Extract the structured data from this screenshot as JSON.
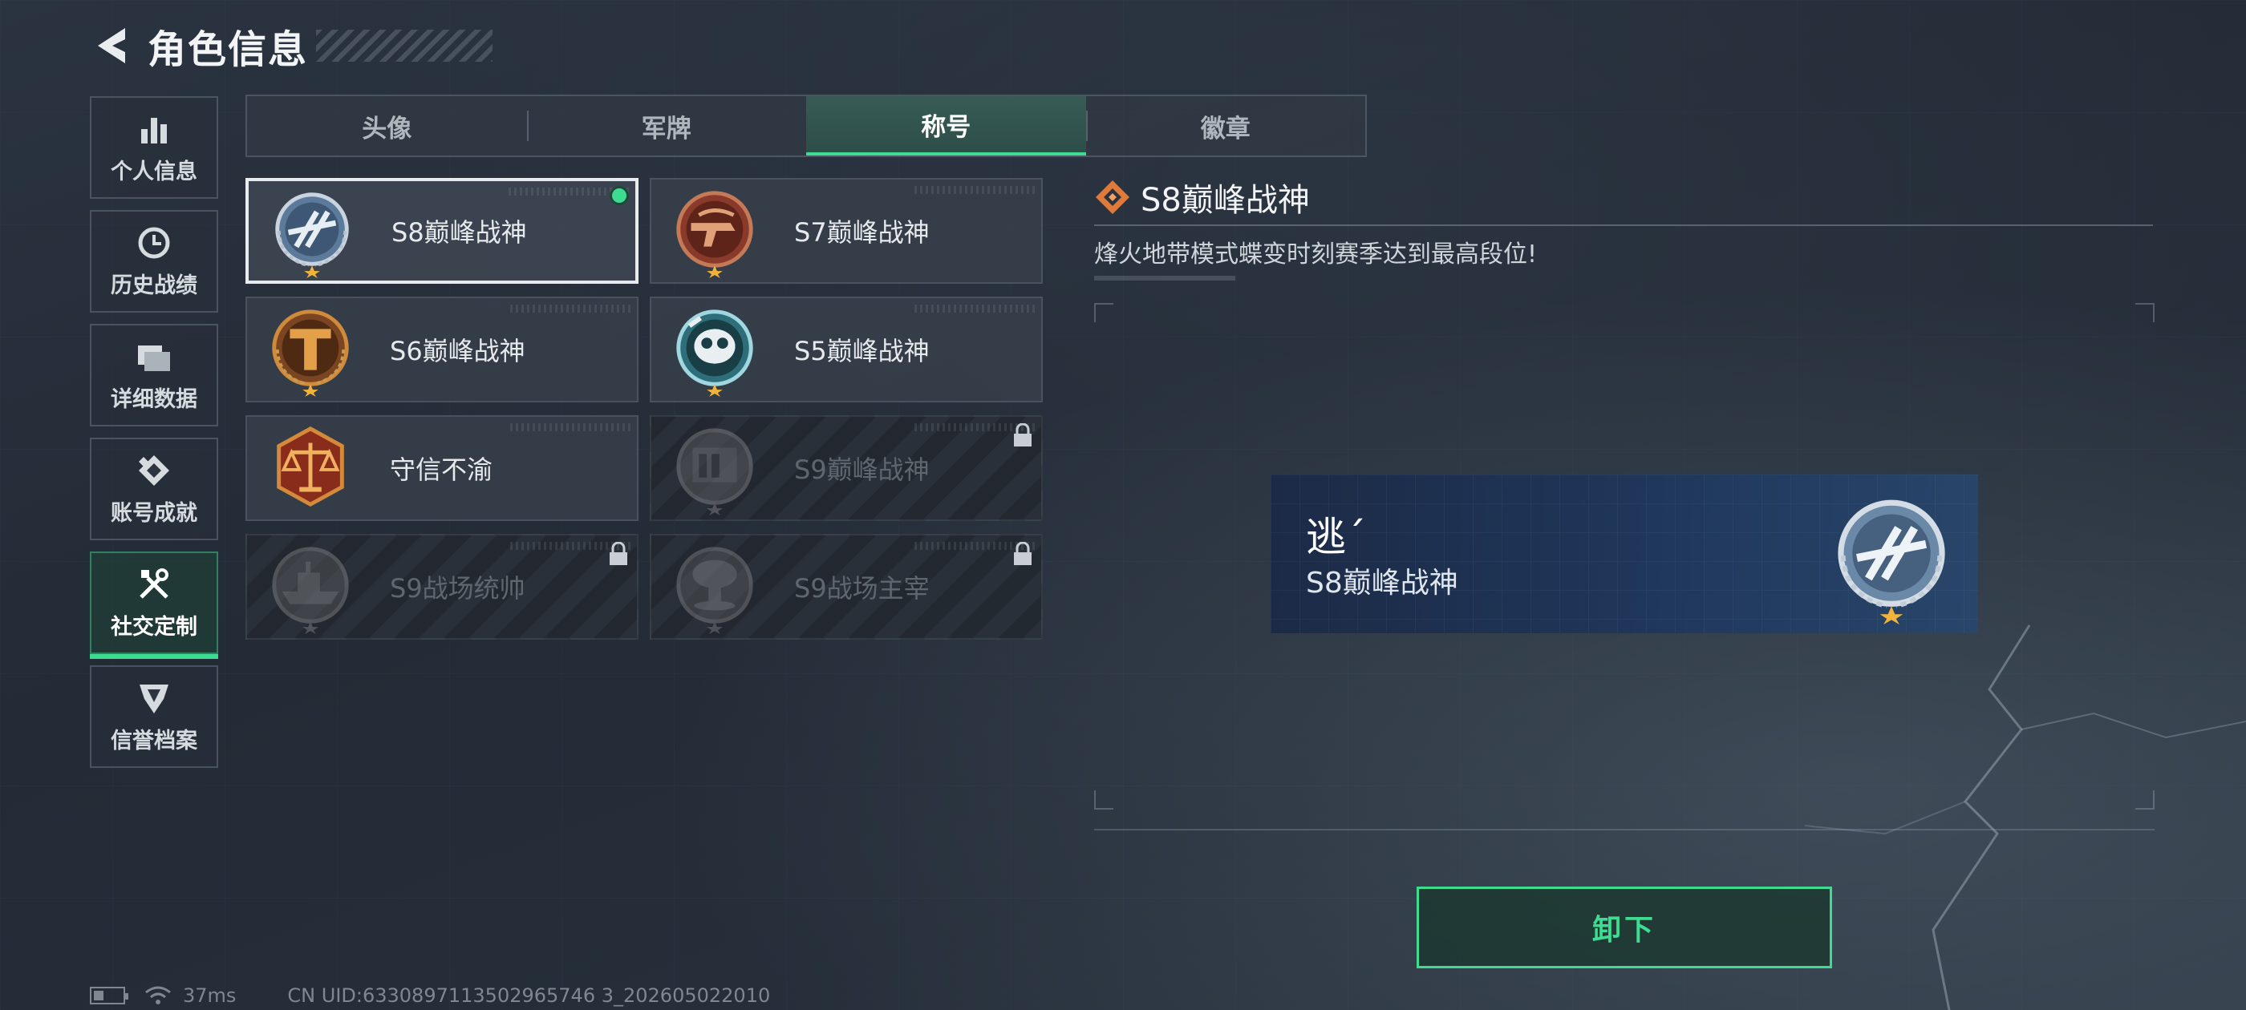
{
  "header": {
    "title": "角色信息"
  },
  "sidebar": {
    "items": [
      {
        "label": "个人信息",
        "icon": "bar-chart-icon"
      },
      {
        "label": "历史战绩",
        "icon": "clock-icon"
      },
      {
        "label": "详细数据",
        "icon": "folder-icon"
      },
      {
        "label": "账号成就",
        "icon": "achievement-icon"
      },
      {
        "label": "社交定制",
        "icon": "tools-icon",
        "active": true
      },
      {
        "label": "信誉档案",
        "icon": "shield-icon"
      }
    ]
  },
  "tabs": [
    {
      "label": "头像"
    },
    {
      "label": "军牌"
    },
    {
      "label": "称号",
      "active": true
    },
    {
      "label": "徽章"
    }
  ],
  "titles": [
    {
      "label": "S8巅峰战神",
      "selected": true,
      "equipped": true,
      "locked": false
    },
    {
      "label": "S7巅峰战神",
      "locked": false
    },
    {
      "label": "S6巅峰战神",
      "locked": false
    },
    {
      "label": "S5巅峰战神",
      "locked": false
    },
    {
      "label": "守信不渝",
      "locked": false
    },
    {
      "label": "S9巅峰战神",
      "locked": true
    },
    {
      "label": "S9战场统帅",
      "locked": true
    },
    {
      "label": "S9战场主宰",
      "locked": true
    }
  ],
  "detail": {
    "title": "S8巅峰战神",
    "description": "烽火地带模式蝶变时刻赛季达到最高段位!"
  },
  "preview": {
    "player_name": "逃´",
    "title": "S8巅峰战神"
  },
  "actions": {
    "unequip_label": "卸下"
  },
  "status": {
    "ping": "37ms",
    "uid": "CN UID:6330897113502965746 3_202605022010"
  },
  "colors": {
    "accent": "#3ddc91",
    "panel": "#37404a",
    "banner": "#1e375c",
    "title_icon": "#e07a3a"
  }
}
